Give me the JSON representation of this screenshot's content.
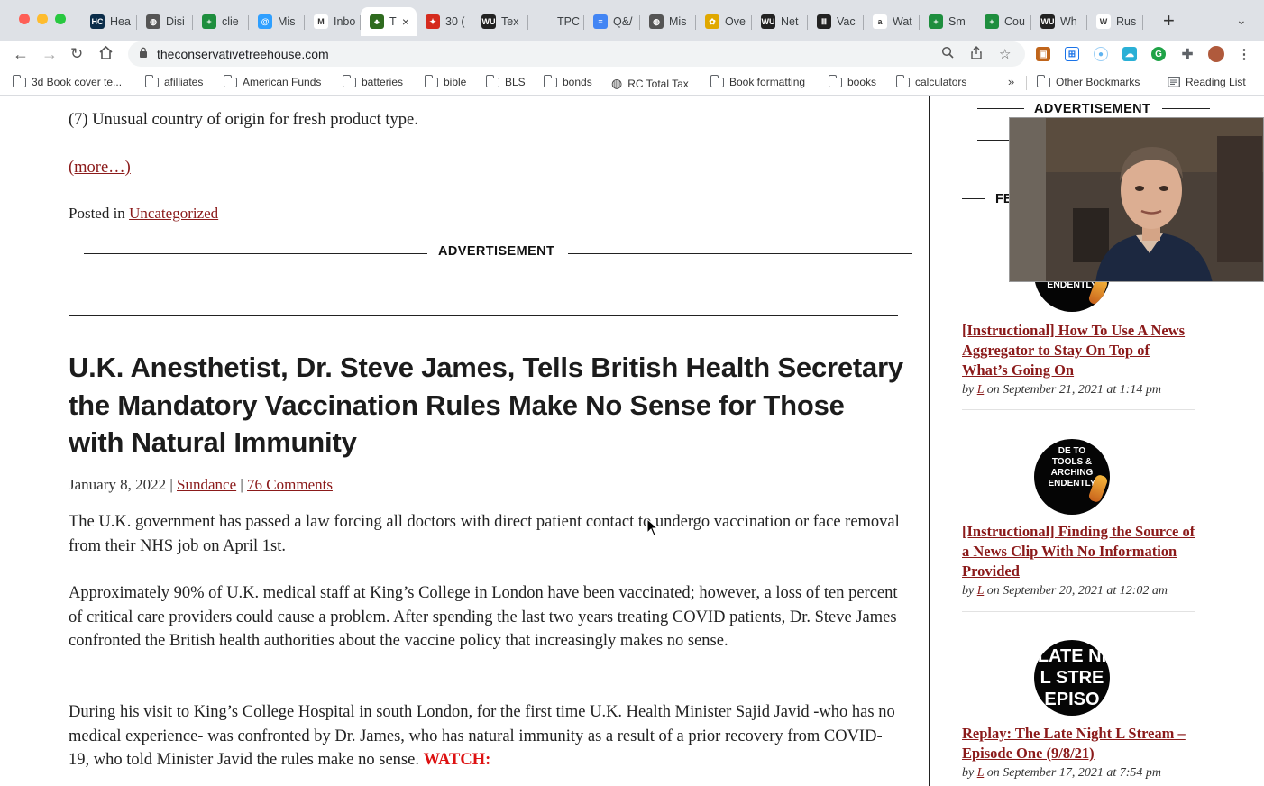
{
  "browser": {
    "tabs": [
      {
        "label": "Hea",
        "favicon": "hc-icon",
        "color": "#0b2d4a",
        "glyph": "HC"
      },
      {
        "label": "Disi",
        "favicon": "globe-icon",
        "color": "#555555",
        "glyph": "◍"
      },
      {
        "label": "clie",
        "favicon": "sheets-icon",
        "color": "#1e8e3e",
        "glyph": "+"
      },
      {
        "label": "Mis",
        "favicon": "disqus-icon",
        "color": "#2e9fff",
        "glyph": "@"
      },
      {
        "label": "Inbo",
        "favicon": "gmail-icon",
        "color": "#ffffff",
        "glyph": "M"
      },
      {
        "label": "T",
        "favicon": "tree-icon",
        "color": "#2f6b1f",
        "glyph": "♣",
        "active": true
      },
      {
        "label": "30 (",
        "favicon": "maple-leaf-icon",
        "color": "#d52b1e",
        "glyph": "✦"
      },
      {
        "label": "Tex",
        "favicon": "wu-icon",
        "color": "#222222",
        "glyph": "WU"
      },
      {
        "label": "TPC",
        "favicon": "blank-icon",
        "color": "#dee1e6",
        "glyph": ""
      },
      {
        "label": "Q&/",
        "favicon": "docs-icon",
        "color": "#4285f4",
        "glyph": "≡"
      },
      {
        "label": "Mis",
        "favicon": "globe-icon",
        "color": "#555555",
        "glyph": "◍"
      },
      {
        "label": "Ove",
        "favicon": "bee-icon",
        "color": "#e0a800",
        "glyph": "✿"
      },
      {
        "label": "Net",
        "favicon": "wu-icon",
        "color": "#222222",
        "glyph": "WU"
      },
      {
        "label": "Vac",
        "favicon": "library-icon",
        "color": "#222222",
        "glyph": "Ⅲ"
      },
      {
        "label": "Wat",
        "favicon": "amazon-icon",
        "color": "#ffffff",
        "glyph": "a"
      },
      {
        "label": "Sm",
        "favicon": "sheets-icon",
        "color": "#1e8e3e",
        "glyph": "+"
      },
      {
        "label": "Cou",
        "favicon": "sheets-icon",
        "color": "#1e8e3e",
        "glyph": "+"
      },
      {
        "label": "Wh",
        "favicon": "wu-icon",
        "color": "#222222",
        "glyph": "WU"
      },
      {
        "label": "Rus",
        "favicon": "wikipedia-icon",
        "color": "#ffffff",
        "glyph": "W"
      }
    ],
    "url": "theconservativetreehouse.com",
    "bookmarks": [
      {
        "label": "3d Book cover te...",
        "icon": "folder-icon"
      },
      {
        "label": "afilliates",
        "icon": "folder-icon"
      },
      {
        "label": "American Funds",
        "icon": "folder-icon"
      },
      {
        "label": "batteries",
        "icon": "folder-icon"
      },
      {
        "label": "bible",
        "icon": "folder-icon"
      },
      {
        "label": "BLS",
        "icon": "folder-icon"
      },
      {
        "label": "bonds",
        "icon": "folder-icon"
      },
      {
        "label": "RC Total Tax",
        "icon": "globe-icon"
      },
      {
        "label": "Book formatting",
        "icon": "folder-icon"
      },
      {
        "label": "books",
        "icon": "folder-icon"
      },
      {
        "label": "calculators",
        "icon": "folder-icon"
      }
    ],
    "more_bookmarks": "»",
    "other_bookmarks": "Other Bookmarks",
    "reading_list": "Reading List"
  },
  "article_prev": {
    "item7": "(7) Unusual country of origin for fresh product type.",
    "more_link": "(more…)",
    "posted_in_label": "Posted in ",
    "category": "Uncategorized"
  },
  "ad_label": "ADVERTISEMENT",
  "post": {
    "title": "U.K. Anesthetist, Dr. Steve James, Tells British Health Secretary the Mandatory Vaccination Rules Make No Sense for Those with Natural Immunity",
    "date": "January 8, 2022",
    "sep": " | ",
    "author": "Sundance",
    "comments": "76 Comments",
    "p1": "The U.K. government has passed a law forcing all doctors with direct patient contact to undergo vaccination or face removal from their NHS job on April 1st.",
    "p2": "Approximately 90% of U.K. medical staff at King’s College in London have been vaccinated; however, a loss of ten percent of critical care providers could cause a problem.  After spending the last two years treating COVID patients, Dr. Steve James confronted the British health authorities about the vaccine policy that increasingly makes no sense.",
    "p3": "During his visit to King’s College Hospital in south London, for the first time U.K. Health Minister Sajid Javid -who has no medical experience- was confronted by Dr. James, who has natural immunity as a result of a prior recovery from COVID-19, who told Minister Javid the rules make no sense. ",
    "watch": "WATCH:"
  },
  "sidebar": {
    "ad_label": "ADVERTISEMENT",
    "featured_partial": "FE",
    "items": [
      {
        "title": "[Instructional] How To Use A News Aggregator to Stay On Top of What’s Going On",
        "by": "by ",
        "author": "L",
        "date": " on September 21, 2021 at 1:14 pm",
        "thumb_text": "ENDENTLY"
      },
      {
        "title": "[Instructional] Finding the Source of a News Clip With No Information Provided",
        "by": "by ",
        "author": "L",
        "date": " on September 20, 2021 at 12:02 am",
        "thumb_text": "DE TO\nTOOLS &\nARCHING\nENDENTLY"
      },
      {
        "title": "Replay: The Late Night L Stream – Episode One (9/8/21)",
        "by": "by ",
        "author": "L",
        "date": " on September 17, 2021 at 7:54 pm",
        "thumb_text": "LATE NI\nL STRE\nEPISO"
      }
    ]
  }
}
